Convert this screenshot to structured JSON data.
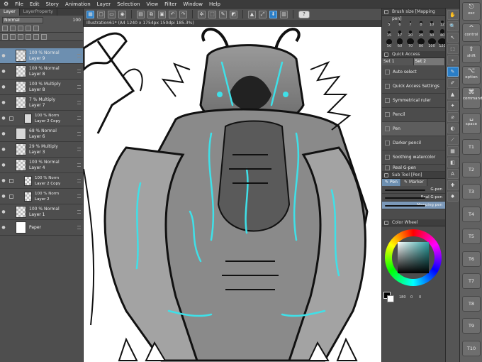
{
  "menubar": {
    "items": [
      "File",
      "Edit",
      "Story",
      "Animation",
      "Layer",
      "Selection",
      "View",
      "Filter",
      "Window",
      "Help"
    ]
  },
  "layer_panel": {
    "tabs": [
      "Layer",
      "LayerProperty"
    ],
    "blend_mode": "Normal",
    "opacity": "100",
    "layers": [
      {
        "l1": "100 % Normal",
        "l2": "Layer 9",
        "selected": true,
        "thumb": "transparent",
        "sub": false
      },
      {
        "l1": "100 % Normal",
        "l2": "Layer 8",
        "thumb": "transparent",
        "sub": false
      },
      {
        "l1": "100 % Multiply",
        "l2": "Layer 8",
        "thumb": "transparent",
        "sub": false
      },
      {
        "l1": "7 % Multiply",
        "l2": "Layer 7",
        "thumb": "transparent",
        "sub": false
      },
      {
        "l1": "100 % Norm",
        "l2": "Layer 2 Copy",
        "thumb": "fig",
        "sub": true
      },
      {
        "l1": "68 % Normal",
        "l2": "Layer 6",
        "thumb": "fig",
        "sub": false
      },
      {
        "l1": "29 % Multiply",
        "l2": "Layer 3",
        "thumb": "transparent",
        "sub": false
      },
      {
        "l1": "100 % Normal",
        "l2": "Layer 4",
        "thumb": "transparent",
        "sub": false
      },
      {
        "l1": "100 % Norm",
        "l2": "Layer 2 Copy",
        "thumb": "transparent",
        "sub": true
      },
      {
        "l1": "100 % Norm",
        "l2": "Layer 2",
        "thumb": "transparent",
        "sub": true
      },
      {
        "l1": "100 % Normal",
        "l2": "Layer 1",
        "thumb": "transparent",
        "sub": false
      },
      {
        "l1": "",
        "l2": "Paper",
        "thumb": "white",
        "sub": false
      }
    ]
  },
  "canvas": {
    "tab_title": "Illustration61* (A4 1240 x 1754px 150dpi 185.3%)"
  },
  "brush_size": {
    "title": "Brush size [Mapping pen]",
    "sizes": [
      "5",
      "6",
      "7",
      "8",
      "10",
      "12",
      "15",
      "17",
      "20",
      "25",
      "30",
      "40",
      "50",
      "60",
      "70",
      "80",
      "100",
      "120"
    ]
  },
  "quick_access": {
    "title": "Quick Access",
    "sets": [
      "Set 1",
      "Set 2"
    ],
    "items": [
      "Auto select",
      "Quick Access Settings",
      "Symmetrical ruler",
      "Pencil",
      "Pen",
      "Darker pencil",
      "Soothing watercolor",
      "Real G-pen"
    ]
  },
  "sub_tool": {
    "title": "Sub Tool [Pen]",
    "tabs": [
      "Pen",
      "Marker"
    ],
    "items": [
      "G-pen",
      "Real G-pen",
      "Mapping pen"
    ]
  },
  "color_wheel": {
    "title": "Color Wheel",
    "v1": "180",
    "v2": "0",
    "v3": "0"
  },
  "tools": [
    "✋",
    "🔍",
    "↖",
    "⬚",
    "⌖",
    "✎",
    "✐",
    "▲",
    "✦",
    "⌀",
    "◐",
    "⟋",
    "▦",
    "◧",
    "A",
    "✚",
    "✸"
  ],
  "keys": {
    "esc": "esc",
    "control": "control",
    "shift": "shift",
    "option": "option",
    "command": "command",
    "space": "space",
    "t": [
      "T1",
      "T2",
      "T3",
      "T4",
      "T5",
      "T6",
      "T7",
      "T8",
      "T9",
      "T10"
    ]
  },
  "colors": {
    "accent": "#2a7ec7",
    "selected_layer": "#6d8fb0",
    "cyan_glow": "#3fe0e8"
  }
}
